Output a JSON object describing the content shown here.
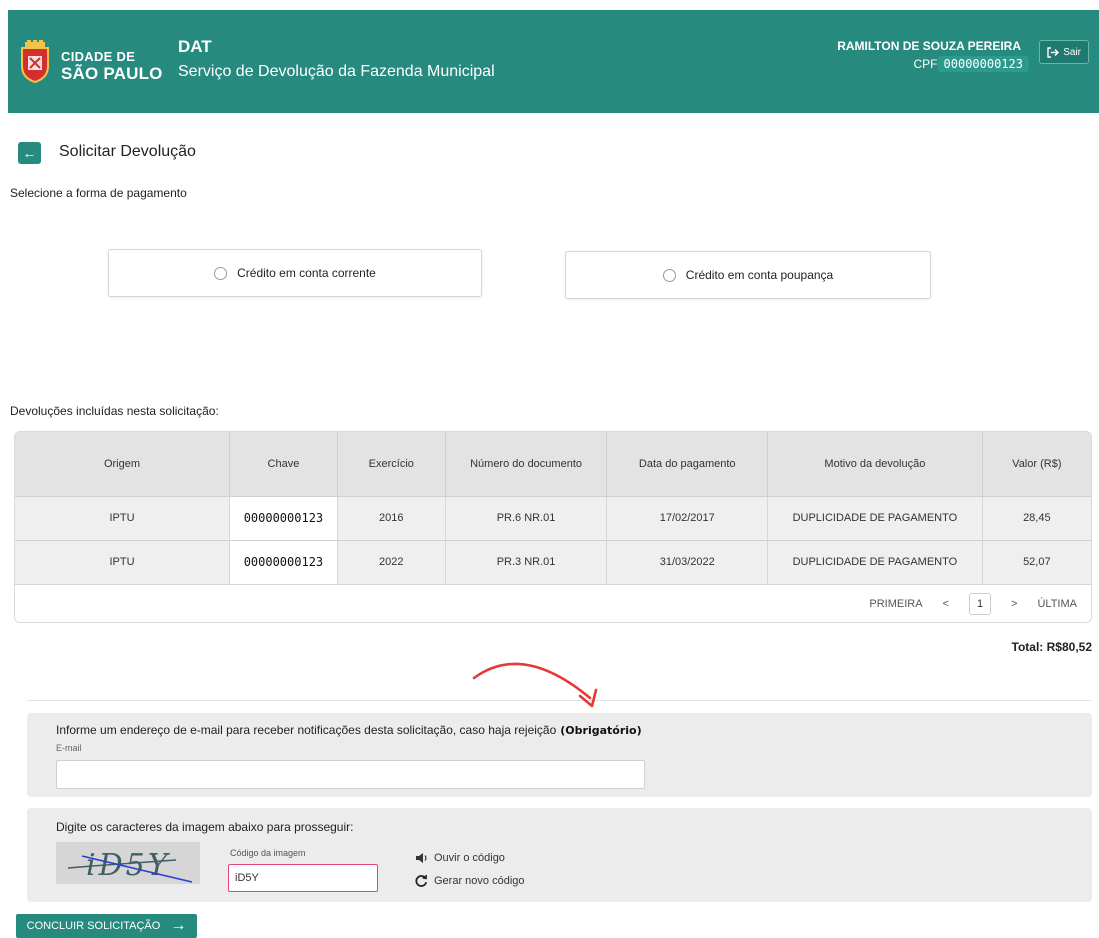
{
  "header": {
    "city_line1": "CIDADE DE",
    "city_line2": "SÃO PAULO",
    "app_title": "DAT",
    "app_subtitle": "Serviço de Devolução da Fazenda Municipal",
    "user_name": "RAMILTON DE SOUZA PEREIRA",
    "cpf_label": "CPF",
    "cpf_value": "00000000123",
    "logout_label": "Sair",
    "logout_icon": "logout-icon",
    "brand_color": "#268a7f"
  },
  "page": {
    "back_icon": "arrow-left-icon",
    "title": "Solicitar Devolução",
    "payment_prompt": "Selecione a forma de pagamento",
    "payment_options": [
      {
        "label": "Crédito em conta corrente"
      },
      {
        "label": "Crédito em conta poupança"
      }
    ]
  },
  "table": {
    "label": "Devoluções incluídas nesta solicitação:",
    "columns": [
      "Origem",
      "Chave",
      "Exercício",
      "Número do documento",
      "Data do pagamento",
      "Motivo da devolução",
      "Valor (R$)"
    ],
    "rows": [
      [
        "IPTU",
        "00000000123",
        "2016",
        "PR.6 NR.01",
        "17/02/2017",
        "DUPLICIDADE DE PAGAMENTO",
        "28,45"
      ],
      [
        "IPTU",
        "00000000123",
        "2022",
        "PR.3 NR.01",
        "31/03/2022",
        "DUPLICIDADE DE PAGAMENTO",
        "52,07"
      ]
    ],
    "pager": {
      "first": "PRIMEIRA",
      "prev": "<",
      "current": "1",
      "next": ">",
      "last": "ÚLTIMA"
    },
    "total_label": "Total:",
    "total_value": "R$80,52"
  },
  "email": {
    "label": "Informe um endereço de e-mail para receber notificações desta solicitação, caso haja rejeição",
    "required_note": "(Obrigatório)",
    "field_label": "E-mail",
    "value": ""
  },
  "captcha": {
    "label": "Digite os caracteres da imagem abaixo para prosseguir:",
    "image_text": "iD5Y",
    "code_label": "Código da imagem",
    "code_value": "iD5Y",
    "listen_label": "Ouvir o código",
    "listen_icon": "speaker-icon",
    "refresh_label": "Gerar novo código",
    "refresh_icon": "refresh-icon"
  },
  "submit": {
    "label": "CONCLUIR SOLICITAÇÃO",
    "icon": "arrow-right-icon"
  },
  "annotation": {
    "color": "#e53935"
  }
}
